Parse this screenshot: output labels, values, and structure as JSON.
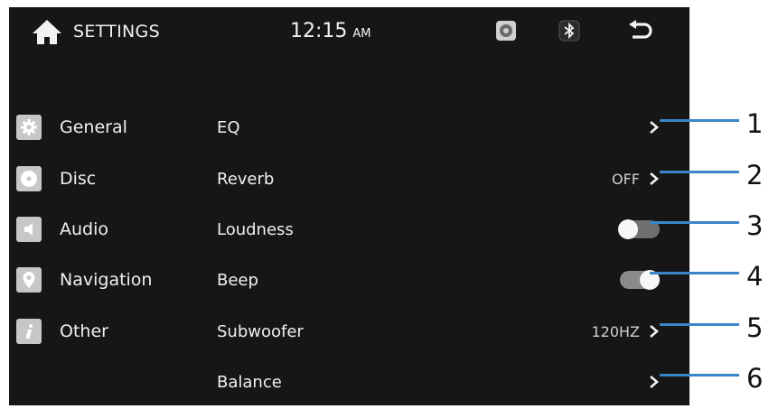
{
  "header": {
    "title": "SETTINGS",
    "time": "12:15",
    "ampm": "AM"
  },
  "sidebar": {
    "items": [
      {
        "label": "General",
        "icon": "gear-icon"
      },
      {
        "label": "Disc",
        "icon": "disc-icon"
      },
      {
        "label": "Audio",
        "icon": "speaker-icon"
      },
      {
        "label": "Navigation",
        "icon": "location-pin-icon"
      },
      {
        "label": "Other",
        "icon": "info-icon"
      }
    ]
  },
  "settings": {
    "rows": [
      {
        "label": "EQ",
        "value": "",
        "control": "chevron"
      },
      {
        "label": "Reverb",
        "value": "OFF",
        "control": "chevron"
      },
      {
        "label": "Loudness",
        "value": "",
        "control": "toggle",
        "state": "off"
      },
      {
        "label": "Beep",
        "value": "",
        "control": "toggle",
        "state": "on"
      },
      {
        "label": "Subwoofer",
        "value": "120HZ",
        "control": "chevron"
      },
      {
        "label": "Balance",
        "value": "",
        "control": "chevron"
      }
    ]
  },
  "callouts": [
    "1",
    "2",
    "3",
    "4",
    "5",
    "6"
  ],
  "colors": {
    "screen_bg": "#161616",
    "callout_line": "#3a86c8",
    "icon_bg": "#c7c7c7"
  }
}
